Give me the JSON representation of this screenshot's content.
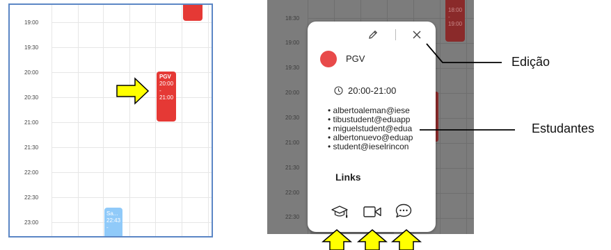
{
  "left_calendar": {
    "times": [
      "19:00",
      "19:30",
      "20:00",
      "20:30",
      "21:00",
      "21:30",
      "22:00",
      "22:30",
      "23:00"
    ],
    "event_main": {
      "title": "PGV",
      "lines": [
        "20:00",
        "-",
        "21:00"
      ]
    },
    "event_small": {
      "title": "Sa...",
      "lines": [
        "22:43",
        "-"
      ]
    }
  },
  "right_calendar": {
    "times": [
      "18:30",
      "19:00",
      "19:30",
      "20:00",
      "20:30",
      "21:00",
      "21:30",
      "22:00",
      "22:30"
    ],
    "event_top": {
      "lines": [
        "18:00",
        "-",
        "19:00"
      ]
    }
  },
  "popup": {
    "title": "PGV",
    "time_range": "20:00-21:00",
    "students": [
      "albertoaleman@iese",
      "tibustudent@eduapp",
      "miguelstudent@edua",
      "albertonuevo@eduap",
      "student@ieselrincon"
    ],
    "links_label": "Links",
    "bullet": "•"
  },
  "callouts": {
    "edit_label": "Edição",
    "students_label": "Estudantes"
  },
  "colors": {
    "event_red": "#e53935",
    "event_blue": "#90caf9",
    "arrow_yellow": "#ffff00",
    "border_blue": "#5b86c5"
  }
}
